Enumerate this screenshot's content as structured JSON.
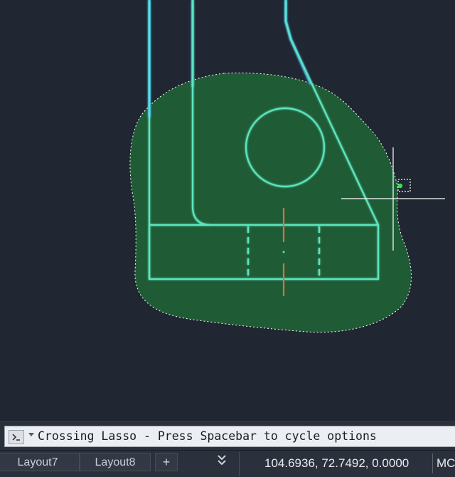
{
  "command_line": {
    "prompt_text": "Crossing Lasso - Press Spacebar to cycle options"
  },
  "layout_tabs": [
    {
      "label": "Layout7"
    },
    {
      "label": "Layout8"
    }
  ],
  "add_tab_label": "+",
  "more_chevron": "⌄",
  "status": {
    "coordinates": "104.6936, 72.7492, 0.0000",
    "model_label": "MC"
  },
  "colors": {
    "canvas": "#212732",
    "lasso_fill": "#1f5c36",
    "geometry": "#5de6c0",
    "highlight_blue": "#3b9fe8",
    "center_mark": "#e0703a",
    "crosshair": "#ffffff"
  },
  "icons": {
    "command_prompt": "prompt-icon",
    "dropdown": "chevron-down-icon",
    "crosshair": "crosshair-cursor-icon"
  }
}
